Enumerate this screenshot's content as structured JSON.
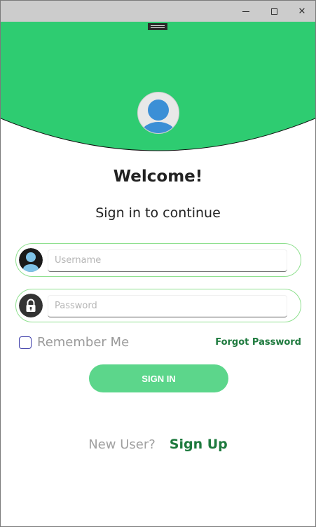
{
  "window": {
    "minimize_glyph": "",
    "maximize_glyph": "",
    "close_glyph": "✕"
  },
  "header": {
    "color": "#2ecc71",
    "avatar_icon": "user-avatar-icon"
  },
  "form": {
    "welcome": "Welcome!",
    "subtitle": "Sign in to continue",
    "username": {
      "placeholder": "Username",
      "value": "",
      "icon": "user-icon"
    },
    "password": {
      "placeholder": "Password",
      "value": "",
      "icon": "lock-icon"
    },
    "remember_label": "Remember Me",
    "remember_checked": false,
    "forgot_label": "Forgot Password",
    "signin_label": "SIGN IN"
  },
  "footer": {
    "new_user_label": "New User?",
    "signup_label": "Sign Up"
  },
  "colors": {
    "accent": "#2ecc71",
    "button": "#5cd68b",
    "link": "#1e7a3e",
    "field_border": "#8fe08f"
  }
}
